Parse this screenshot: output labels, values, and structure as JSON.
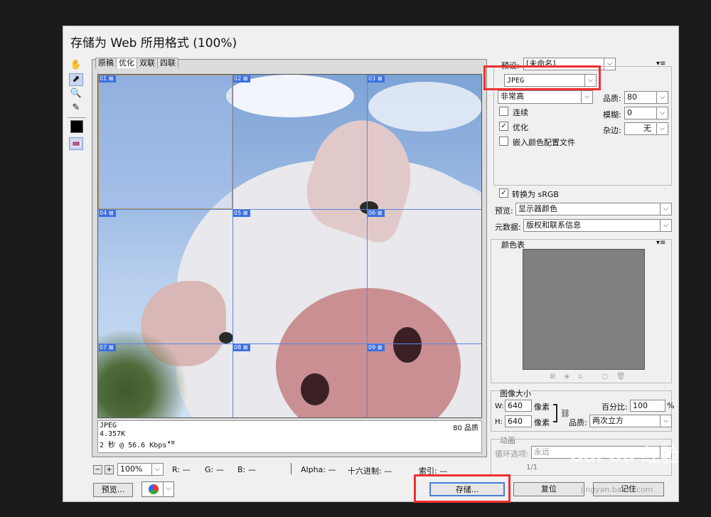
{
  "dialog": {
    "title": "存储为 Web 所用格式 (100%)"
  },
  "tabs": [
    "原稿",
    "优化",
    "双联",
    "四联"
  ],
  "tools": {
    "hand": "✋",
    "slice_select": "⬈",
    "zoom": "🔍",
    "eyedropper": "✎"
  },
  "slices": [
    "01",
    "02",
    "03",
    "04",
    "05",
    "06",
    "07",
    "08",
    "09"
  ],
  "info": {
    "format": "JPEG",
    "size": "4.357K",
    "time": "2 秒 @ 56.6 Kbps",
    "quality": "80 品质"
  },
  "statusbar": {
    "zoom": "100%",
    "r": "R: —",
    "g": "G: —",
    "b": "B: —",
    "alpha": "Alpha: —",
    "hex": "十六进制: —",
    "index": "索引: —"
  },
  "buttons": {
    "preview": "预览...",
    "save": "存储...",
    "reset": "复位",
    "remember": "记住"
  },
  "settings": {
    "preset_label": "预设:",
    "preset_value": "[未命名]",
    "format": "JPEG",
    "quality_preset": "非常高",
    "quality_label": "品质:",
    "quality_value": "80",
    "blur_label": "模糊:",
    "blur_value": "0",
    "matte_label": "杂边:",
    "matte_value": "无",
    "progressive": "连续",
    "optimized": "优化",
    "embed_profile": "嵌入颜色配置文件",
    "convert_srgb": "转换为 sRGB",
    "preview_label": "预览:",
    "preview_value": "显示器颜色",
    "metadata_label": "元数据:",
    "metadata_value": "版权和联系信息"
  },
  "color_table": {
    "title": "颜色表"
  },
  "image_size": {
    "title": "图像大小",
    "w_label": "W:",
    "w_value": "640",
    "h_label": "H:",
    "h_value": "640",
    "unit": "像素",
    "percent_label": "百分比:",
    "percent_value": "100",
    "percent_sign": "%",
    "quality_label": "品质:",
    "quality_value": "两次立方"
  },
  "animation": {
    "title": "动画",
    "loop_label": "循环选项:",
    "loop_value": "永远",
    "frame": "1/1"
  },
  "watermark": {
    "logo": "Bai du 经验",
    "url": "jingyan.baidu.com"
  },
  "colors": {
    "highlight": "#ef2f2f",
    "slice": "#3c6fe0"
  }
}
